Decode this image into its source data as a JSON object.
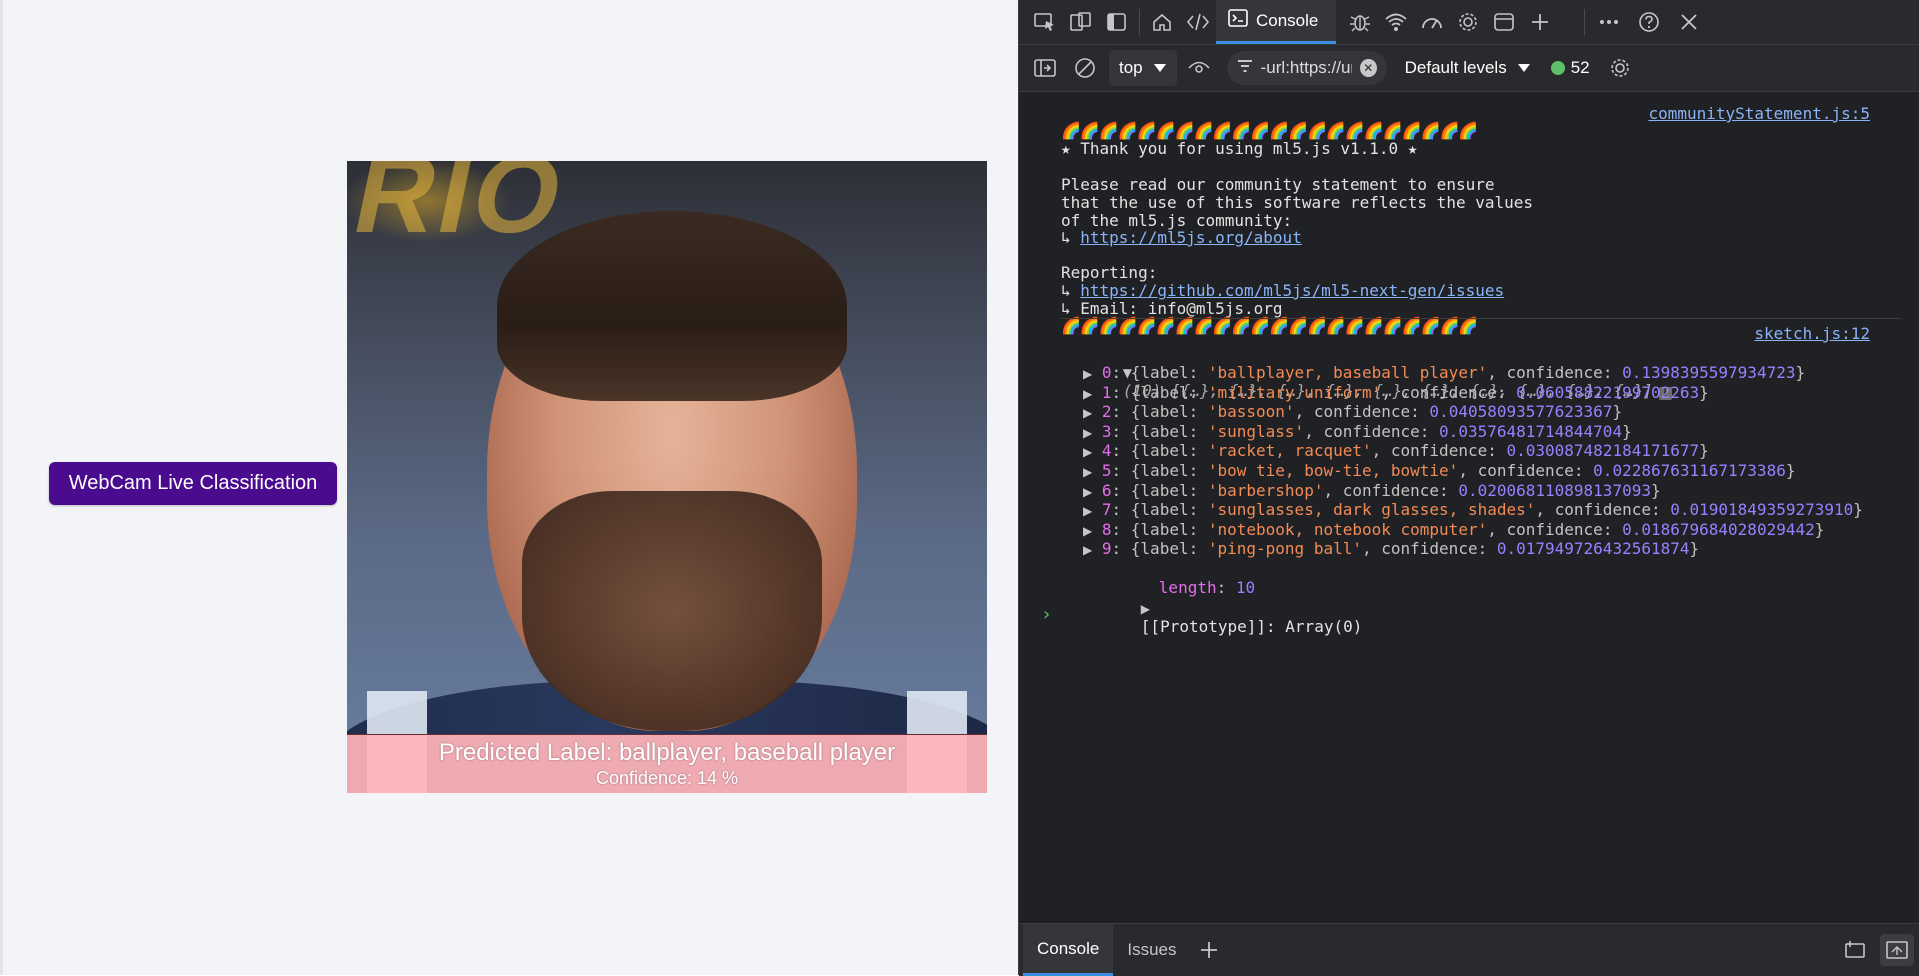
{
  "page": {
    "button_label": "WebCam Live Classification",
    "predicted_label_text": "Predicted Label: ballplayer, baseball player",
    "confidence_text": "Confidence: 14 %",
    "accent_color": "#4a0b8e"
  },
  "devtools": {
    "toolbar_icons": [
      "inspect-icon",
      "device-icon",
      "sidebar-icon",
      "welcome-icon",
      "elements-icon",
      "console-icon",
      "sources-icon",
      "network-icon",
      "performance-icon",
      "settings-gear-icon",
      "application-icon",
      "add-icon",
      "more-icon",
      "help-icon",
      "close-icon"
    ],
    "active_tab": "Console",
    "context": "top",
    "filter_text": "-url:https://ur",
    "levels_label": "Default levels",
    "message_count": "52",
    "drawer_tabs": [
      "Console",
      "Issues"
    ]
  },
  "console": {
    "statement_source": "communityStatement.js:5",
    "rainbow_line": "🌈🌈🌈🌈🌈🌈🌈🌈🌈🌈🌈🌈🌈🌈🌈🌈🌈🌈🌈🌈🌈🌈",
    "thanks_line": "★ Thank you for using ml5.js v1.1.0 ★",
    "statement_line1": "Please read our community statement to ensure",
    "statement_line2": "that the use of this software reflects the values",
    "statement_line3": "of the ml5.js community:",
    "about_prefix": "↳ ",
    "about_link": "https://ml5js.org/about",
    "reporting_label": "Reporting:",
    "issues_link": "https://github.com/ml5js/ml5-next-gen/issues",
    "email_line": "↳ Email: info@ml5js.org",
    "sketch_source": "sketch.js:12",
    "array_summary": "(10) [{…}, {…}, {…}, {…}, {…}, {…}, {…}, {…}, {…}, {…}]",
    "results": [
      {
        "index": "0",
        "label": "'ballplayer, baseball player'",
        "confidence": "0.1398395597934723"
      },
      {
        "index": "1",
        "label": "'military uniform'",
        "confidence": "0.06058822199702263"
      },
      {
        "index": "2",
        "label": "'bassoon'",
        "confidence": "0.04058093577623367"
      },
      {
        "index": "3",
        "label": "'sunglass'",
        "confidence": "0.03576481714844704"
      },
      {
        "index": "4",
        "label": "'racket, racquet'",
        "confidence": "0.030087482184171677"
      },
      {
        "index": "5",
        "label": "'bow tie, bow-tie, bowtie'",
        "confidence": "0.022867631167173386"
      },
      {
        "index": "6",
        "label": "'barbershop'",
        "confidence": "0.020068110898137093"
      },
      {
        "index": "7",
        "label": "'sunglasses, dark glasses, shades'",
        "confidence": "0.01901849359273910"
      },
      {
        "index": "8",
        "label": "'notebook, notebook computer'",
        "confidence": "0.018679684028029442"
      },
      {
        "index": "9",
        "label": "'ping-pong ball'",
        "confidence": "0.017949726432561874"
      }
    ],
    "length_key": "length",
    "length_value": "10",
    "prototype_line": "[[Prototype]]: Array(0)"
  }
}
